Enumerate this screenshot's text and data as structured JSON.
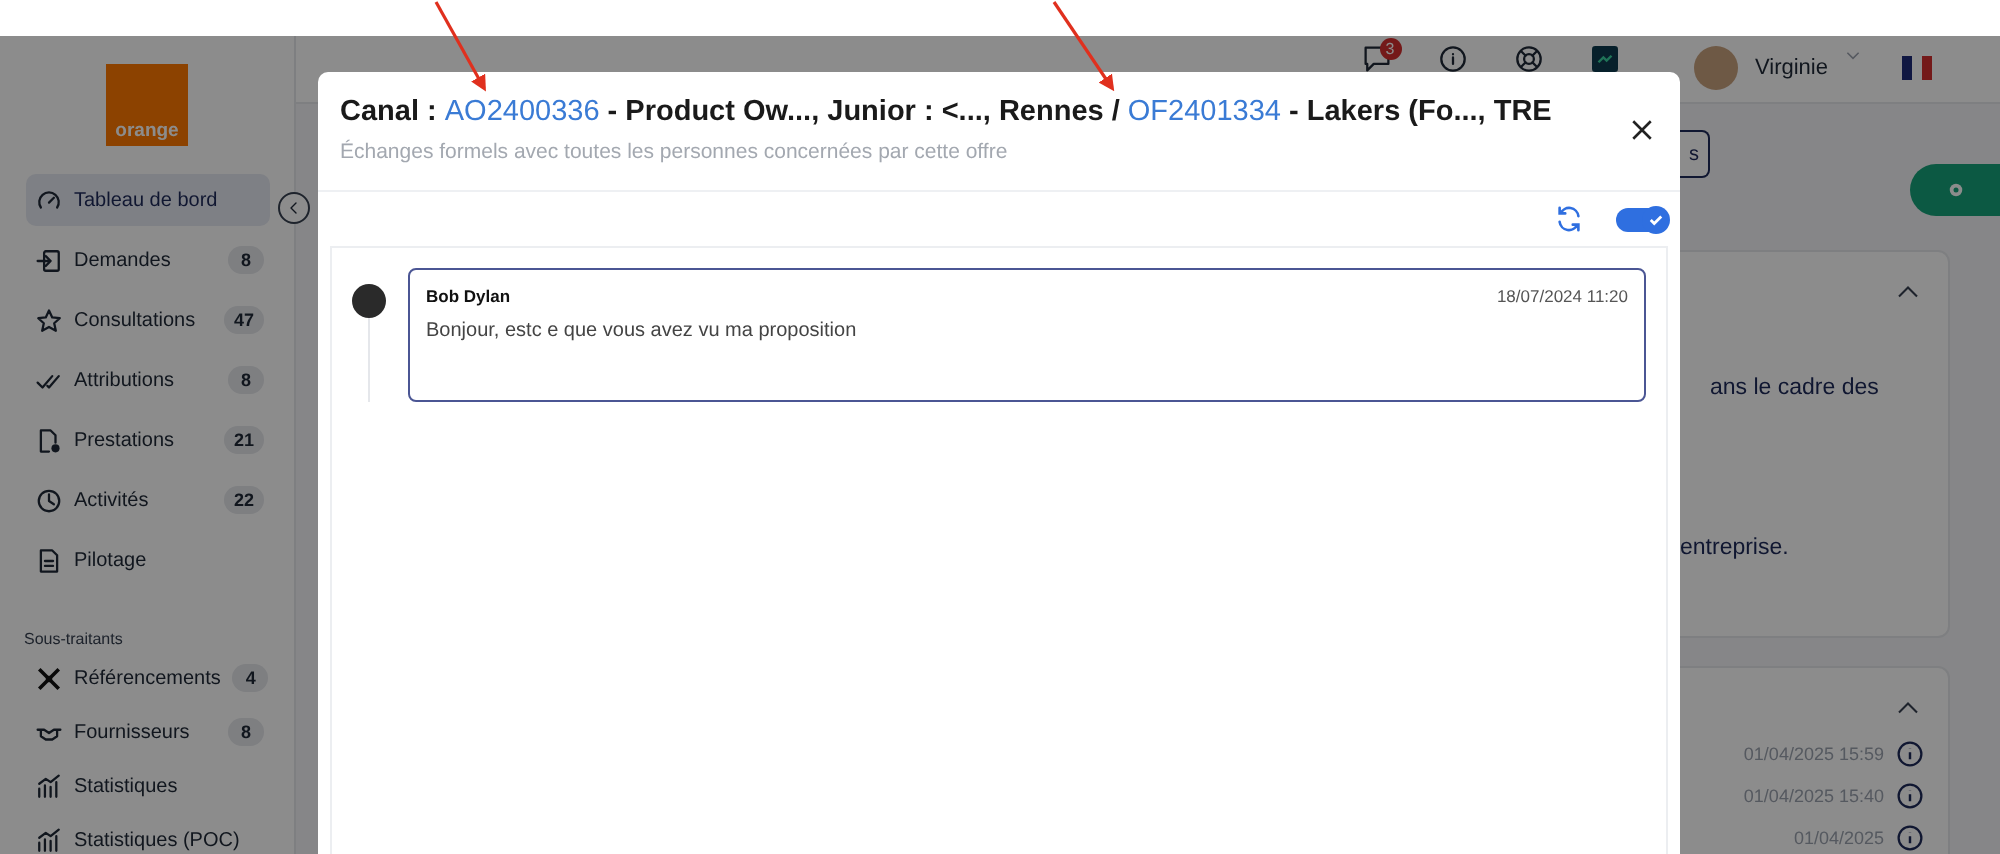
{
  "sidebar": {
    "logo": "orange",
    "items": [
      {
        "label": "Tableau de bord",
        "selected": true
      },
      {
        "label": "Demandes",
        "count": "8",
        "selected": false
      },
      {
        "label": "Consultations",
        "count": "47",
        "selected": false
      },
      {
        "label": "Attributions",
        "count": "8",
        "selected": false
      },
      {
        "label": "Prestations",
        "count": "21",
        "selected": false
      },
      {
        "label": "Activités",
        "count": "22",
        "selected": false
      },
      {
        "label": "Pilotage",
        "selected": false
      }
    ],
    "section": {
      "title": "Sous-traitants",
      "items": [
        {
          "label": "Référencements",
          "count": "4",
          "selected": false
        },
        {
          "label": "Fournisseurs",
          "count": "8",
          "selected": false
        },
        {
          "label": "Statistiques",
          "selected": false
        },
        {
          "label": "Statistiques (POC)",
          "selected": false
        }
      ]
    }
  },
  "topbar": {
    "notification_count": "3",
    "user": "Virginie"
  },
  "background": {
    "button_fragment": "s",
    "texts": [
      "ans le cadre des",
      "entreprise."
    ],
    "timestamps": [
      "01/04/2025 15:59",
      "01/04/2025 15:40",
      "01/04/2025"
    ]
  },
  "modal": {
    "title": [
      {
        "kind": "plain",
        "text": "Canal : "
      },
      {
        "kind": "link",
        "text": "AO2400336"
      },
      {
        "kind": "plain",
        "text": " - Product Ow..., Junior : <..., Rennes / "
      },
      {
        "kind": "link",
        "text": "OF2401334"
      },
      {
        "kind": "plain",
        "text": " - Lakers (Fo..., TRE"
      }
    ],
    "subtitle": "Échanges formels avec toutes les personnes concernées par cette offre",
    "live_toggle": {
      "on": true
    },
    "messages": [
      {
        "author": "Bob Dylan",
        "time": "18/07/2024 11:20",
        "text": "Bonjour, estc e que vous avez vu ma proposition"
      }
    ]
  }
}
